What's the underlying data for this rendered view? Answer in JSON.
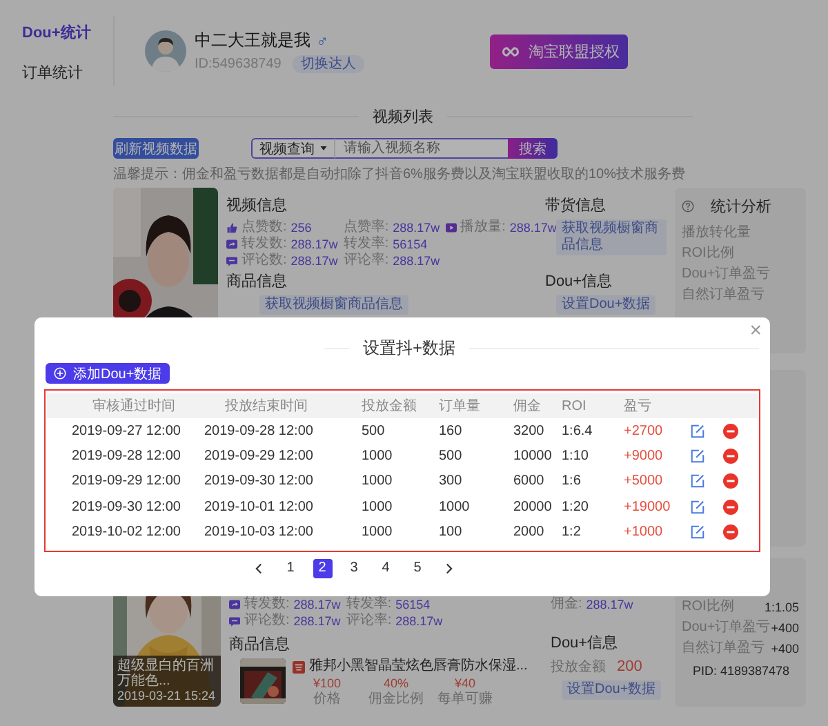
{
  "sidebar": {
    "items": [
      {
        "label": "Dou+统计",
        "selected": true
      },
      {
        "label": "订单统计",
        "selected": false
      }
    ]
  },
  "profile": {
    "name": "中二大王就是我",
    "gender": "♂",
    "id": "ID:549638749",
    "switch_button": "切换达人"
  },
  "auth_button": "淘宝联盟授权",
  "section_title": "视频列表",
  "toolbar": {
    "refresh_button": "刷新视频数据",
    "search_type": "视频查询",
    "search_placeholder": "请输入视频名称",
    "search_button": "搜索"
  },
  "tip": "温馨提示：佣金和盈亏数据都是自动扣除了抖音6%服务费以及淘宝联盟收取的10%技术服务费",
  "first_video": {
    "video_info_title": "视频信息",
    "stats": [
      [
        {
          "kind": "thumb",
          "label": "点赞数:",
          "value": "256"
        },
        {
          "kind": "plain",
          "label": "点赞率:",
          "value": "288.17w"
        },
        {
          "kind": "play",
          "label": "播放量:",
          "value": "288.17w"
        }
      ],
      [
        {
          "kind": "share",
          "label": "转发数:",
          "value": "288.17w"
        },
        {
          "kind": "plain",
          "label": "转发率:",
          "value": "56154"
        }
      ],
      [
        {
          "kind": "comment",
          "label": "评论数:",
          "value": "288.17w"
        },
        {
          "kind": "plain",
          "label": "评论率:",
          "value": "288.17w"
        }
      ]
    ],
    "sales_title": "带货信息",
    "sales_button": "获取视频橱窗商品信息",
    "product_title": "商品信息",
    "product_button": "获取视频橱窗商品信息",
    "dou_title": "Dou+信息",
    "dou_button": "设置Dou+数据",
    "analysis": {
      "title": "统计分析",
      "rows": [
        "播放转化量",
        "ROI比例",
        "Dou+订单盈亏",
        "自然订单盈亏"
      ]
    }
  },
  "second_video": {
    "caption": "超级显白的百洲万能色...",
    "date": "2019-03-21 15:24",
    "stats": [
      [
        {
          "kind": "share",
          "label": "转发数:",
          "value": "288.17w"
        },
        {
          "kind": "plain",
          "label": "转发率:",
          "value": "56154"
        }
      ],
      [
        {
          "kind": "comment",
          "label": "评论数:",
          "value": "288.17w"
        },
        {
          "kind": "plain",
          "label": "评论率:",
          "value": "288.17w"
        }
      ]
    ],
    "commission": {
      "label": "佣金:",
      "value": "288.17w"
    },
    "product_title": "商品信息",
    "product": {
      "name": "雅邦小黑智晶莹炫色唇膏防水保湿...",
      "metrics": [
        {
          "value": "¥100",
          "label": "价格"
        },
        {
          "value": "40%",
          "label": "佣金比例"
        },
        {
          "value": "¥40",
          "label": "每单可赚"
        }
      ]
    },
    "dou_title": "Dou+信息",
    "dou_amount_label": "投放金额",
    "dou_amount": "200",
    "dou_button": "设置Dou+数据",
    "analysis_rows": [
      {
        "label": "ROI比例",
        "value": "1:1.05"
      },
      {
        "label": "Dou+订单盈亏",
        "value": "+400"
      },
      {
        "label": "自然订单盈亏",
        "value": "+400"
      }
    ],
    "pid": "PID: 4189387478"
  },
  "dialog": {
    "title": "设置抖+数据",
    "close": "×",
    "add_button": "添加Dou+数据",
    "columns": [
      "审核通过时间",
      "投放结束时间",
      "投放金额",
      "订单量",
      "佣金",
      "ROI",
      "盈亏"
    ],
    "rows": [
      [
        "2019-09-27 12:00",
        "2019-09-28 12:00",
        "500",
        "160",
        "3200",
        "1:6.4",
        "+2700"
      ],
      [
        "2019-09-28 12:00",
        "2019-09-29 12:00",
        "1000",
        "500",
        "10000",
        "1:10",
        "+9000"
      ],
      [
        "2019-09-29 12:00",
        "2019-09-30 12:00",
        "1000",
        "300",
        "6000",
        "1:6",
        "+5000"
      ],
      [
        "2019-09-30 12:00",
        "2019-10-01 12:00",
        "1000",
        "1000",
        "20000",
        "1:20",
        "+19000"
      ],
      [
        "2019-10-02 12:00",
        "2019-10-03 12:00",
        "1000",
        "100",
        "2000",
        "1:2",
        "+1000"
      ]
    ],
    "pages": [
      {
        "label": "1",
        "selected": false
      },
      {
        "label": "2",
        "selected": true
      },
      {
        "label": "3",
        "selected": false
      },
      {
        "label": "4",
        "selected": false
      },
      {
        "label": "5",
        "selected": false
      }
    ]
  }
}
